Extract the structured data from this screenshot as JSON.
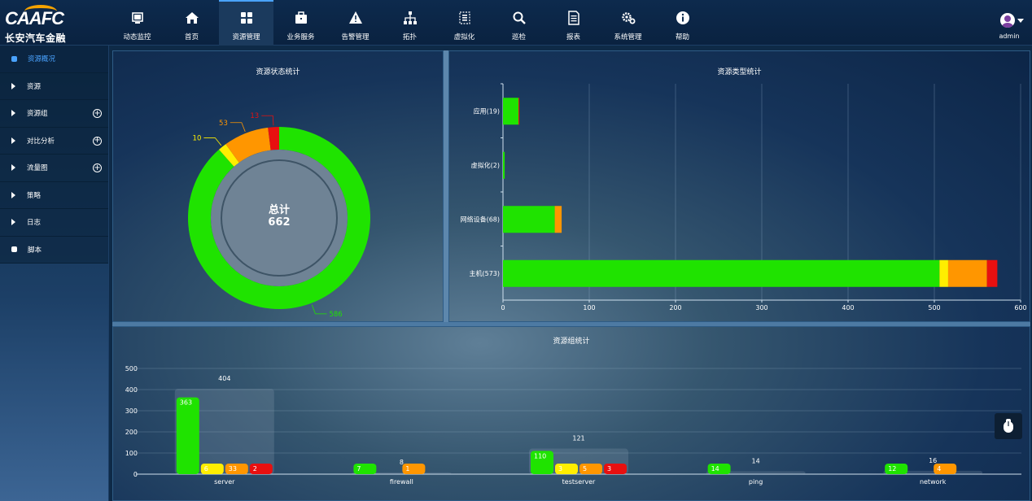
{
  "logo": {
    "brand": "CAAFC",
    "name": "长安汽车金融"
  },
  "nav": [
    {
      "label": "动态监控",
      "icon": "monitor-icon"
    },
    {
      "label": "首页",
      "icon": "home-icon"
    },
    {
      "label": "资源管理",
      "icon": "grid-icon",
      "active": true
    },
    {
      "label": "业务服务",
      "icon": "briefcase-icon"
    },
    {
      "label": "告警管理",
      "icon": "warning-icon"
    },
    {
      "label": "拓扑",
      "icon": "topology-icon"
    },
    {
      "label": "虚拟化",
      "icon": "virtual-icon"
    },
    {
      "label": "巡检",
      "icon": "search-icon"
    },
    {
      "label": "报表",
      "icon": "report-icon"
    },
    {
      "label": "系统管理",
      "icon": "gear-icon"
    },
    {
      "label": "帮助",
      "icon": "info-icon"
    }
  ],
  "user": {
    "name": "admin"
  },
  "sidebar": [
    {
      "label": "资源概况",
      "marker": "dot",
      "active": true
    },
    {
      "label": "资源",
      "marker": "arrow"
    },
    {
      "label": "资源组",
      "marker": "arrow",
      "plus": true
    },
    {
      "label": "对比分析",
      "marker": "arrow",
      "plus": true
    },
    {
      "label": "流量图",
      "marker": "arrow",
      "plus": true
    },
    {
      "label": "策略",
      "marker": "arrow"
    },
    {
      "label": "日志",
      "marker": "arrow"
    },
    {
      "label": "脚本",
      "marker": "dot"
    }
  ],
  "colors": {
    "green": "#1fe300",
    "yellow": "#ffee00",
    "orange": "#ff9600",
    "red": "#e81010"
  },
  "chart_data": [
    {
      "type": "pie",
      "title": "资源状态统计",
      "center_label": "总计",
      "center_value": "662",
      "slices": [
        {
          "value": 586,
          "label": "586",
          "color": "#1fe300"
        },
        {
          "value": 10,
          "label": "10",
          "color": "#ffee00"
        },
        {
          "value": 53,
          "label": "53",
          "color": "#ff9600"
        },
        {
          "value": 13,
          "label": "13",
          "color": "#e81010"
        }
      ]
    },
    {
      "type": "bar",
      "orientation": "horizontal",
      "stacked": true,
      "title": "资源类型统计",
      "categories": [
        "应用(19)",
        "虚拟化(2)",
        "网络设备(68)",
        "主机(573)"
      ],
      "series": [
        {
          "color": "#1fe300",
          "values": [
            18,
            2,
            60,
            506
          ]
        },
        {
          "color": "#ffee00",
          "values": [
            0,
            0,
            0,
            10
          ]
        },
        {
          "color": "#ff9600",
          "values": [
            0,
            0,
            8,
            45
          ]
        },
        {
          "color": "#e81010",
          "values": [
            1,
            0,
            0,
            12
          ]
        }
      ],
      "xlim": [
        0,
        600
      ],
      "xticks": [
        "0",
        "100",
        "200",
        "300",
        "400",
        "500",
        "600"
      ],
      "grid": true
    },
    {
      "type": "bar",
      "stacked": false,
      "title": "资源组统计",
      "categories": [
        "server",
        "firewall",
        "testserver",
        "ping",
        "network"
      ],
      "totals": [
        404,
        8,
        121,
        14,
        16
      ],
      "series": [
        {
          "color": "#1fe300",
          "values": [
            363,
            7,
            110,
            14,
            12
          ]
        },
        {
          "color": "#ffee00",
          "values": [
            6,
            0,
            3,
            0,
            0
          ]
        },
        {
          "color": "#ff9600",
          "values": [
            33,
            1,
            5,
            0,
            4
          ]
        },
        {
          "color": "#e81010",
          "values": [
            2,
            0,
            3,
            0,
            0
          ]
        }
      ],
      "ylim": [
        0,
        500
      ],
      "yticks": [
        "0",
        "100",
        "200",
        "300",
        "400",
        "500"
      ],
      "ytick_labels_visible": [
        "0",
        "100",
        "200",
        "300",
        "400",
        "500"
      ],
      "grid": true
    }
  ]
}
